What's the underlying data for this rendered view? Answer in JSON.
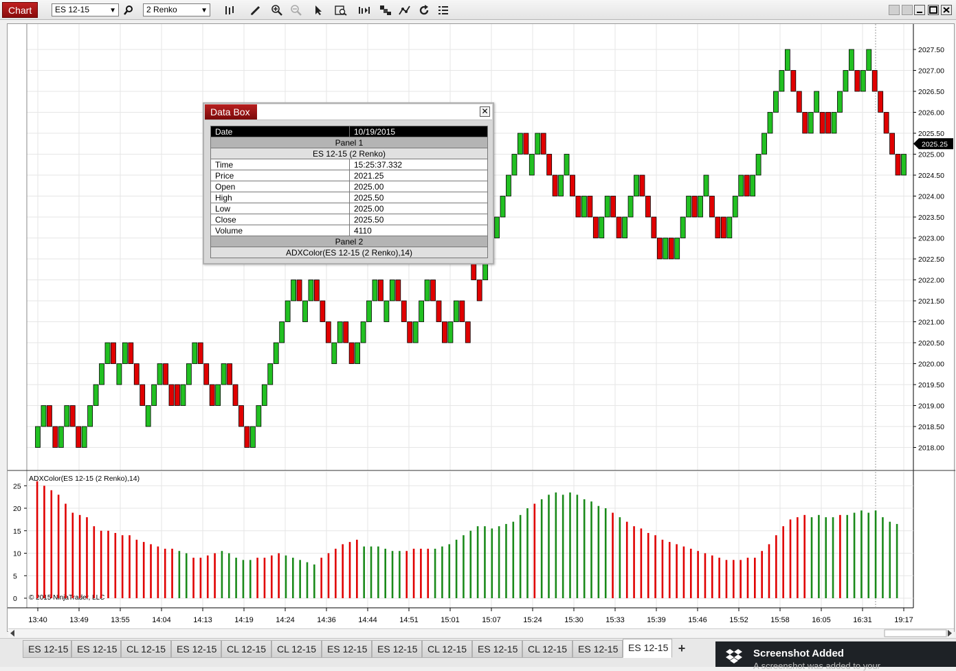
{
  "toolbar": {
    "chart_label": "Chart",
    "instrument": "ES 12-15",
    "bar_type": "2 Renko",
    "icons": [
      "search-icon",
      "bars-type-icon",
      "pencil-icon",
      "zoom-in-icon",
      "zoom-out-icon",
      "pointer-icon",
      "data-box-icon",
      "bar-spacing-icon",
      "properties-icon",
      "indicators-icon",
      "reload-icon",
      "list-icon"
    ]
  },
  "databox": {
    "title": "Data Box",
    "date_label": "Date",
    "date_value": "10/19/2015",
    "panel1": "Panel 1",
    "series1": "ES 12-15 (2 Renko)",
    "rows": [
      {
        "label": "Time",
        "value": "15:25:37.332"
      },
      {
        "label": "Price",
        "value": "2021.25"
      },
      {
        "label": "Open",
        "value": "2025.00"
      },
      {
        "label": "High",
        "value": "2025.50"
      },
      {
        "label": "Low",
        "value": "2025.00"
      },
      {
        "label": "Close",
        "value": "2025.50"
      },
      {
        "label": "Volume",
        "value": "4110"
      }
    ],
    "panel2": "Panel 2",
    "series2": "ADXColor(ES 12-15 (2 Renko),14)"
  },
  "chart_data": {
    "type": "candlestick",
    "y_ticks": [
      "2027.50",
      "2027.00",
      "2026.50",
      "2026.00",
      "2025.50",
      "2025.00",
      "2024.50",
      "2024.00",
      "2023.50",
      "2023.00",
      "2022.50",
      "2022.00",
      "2021.50",
      "2021.00",
      "2020.50",
      "2020.00",
      "2019.50",
      "2019.00",
      "2018.50",
      "2018.00"
    ],
    "ylim": [
      2017.8,
      2028.0
    ],
    "last_price": "2025.25",
    "brick_size": 0.5,
    "x_ticks": [
      "13:40",
      "13:49",
      "13:55",
      "14:04",
      "14:13",
      "14:19",
      "14:24",
      "14:36",
      "14:44",
      "14:51",
      "15:01",
      "15:07",
      "15:24",
      "15:30",
      "15:33",
      "15:39",
      "15:46",
      "15:52",
      "15:58",
      "16:05",
      "16:31",
      "19:17"
    ],
    "up_color": "#22c022",
    "down_color": "#e00000",
    "bricks": [
      [
        "u",
        2018.5
      ],
      [
        "u",
        2019.0
      ],
      [
        "d",
        2019.0
      ],
      [
        "d",
        2018.5
      ],
      [
        "u",
        2018.5
      ],
      [
        "u",
        2019.0
      ],
      [
        "d",
        2019.0
      ],
      [
        "d",
        2018.5
      ],
      [
        "u",
        2018.5
      ],
      [
        "u",
        2019.0
      ],
      [
        "u",
        2019.5
      ],
      [
        "u",
        2020.0
      ],
      [
        "u",
        2020.5
      ],
      [
        "d",
        2020.5
      ],
      [
        "u",
        2020.0
      ],
      [
        "u",
        2020.5
      ],
      [
        "d",
        2020.5
      ],
      [
        "d",
        2020.0
      ],
      [
        "d",
        2019.5
      ],
      [
        "u",
        2019.0
      ],
      [
        "u",
        2019.5
      ],
      [
        "u",
        2020.0
      ],
      [
        "d",
        2020.0
      ],
      [
        "d",
        2019.5
      ],
      [
        "d",
        2019.5
      ],
      [
        "u",
        2019.5
      ],
      [
        "u",
        2020.0
      ],
      [
        "u",
        2020.5
      ],
      [
        "d",
        2020.5
      ],
      [
        "d",
        2020.0
      ],
      [
        "d",
        2019.5
      ],
      [
        "u",
        2019.5
      ],
      [
        "u",
        2020.0
      ],
      [
        "d",
        2020.0
      ],
      [
        "d",
        2019.5
      ],
      [
        "d",
        2019.0
      ],
      [
        "d",
        2018.5
      ],
      [
        "u",
        2018.5
      ],
      [
        "u",
        2019.0
      ],
      [
        "u",
        2019.5
      ],
      [
        "u",
        2020.0
      ],
      [
        "u",
        2020.5
      ],
      [
        "u",
        2021.0
      ],
      [
        "u",
        2021.5
      ],
      [
        "u",
        2022.0
      ],
      [
        "d",
        2022.0
      ],
      [
        "u",
        2021.5
      ],
      [
        "u",
        2022.0
      ],
      [
        "d",
        2022.0
      ],
      [
        "d",
        2021.5
      ],
      [
        "d",
        2021.0
      ],
      [
        "u",
        2020.5
      ],
      [
        "u",
        2021.0
      ],
      [
        "d",
        2021.0
      ],
      [
        "d",
        2020.5
      ],
      [
        "u",
        2020.5
      ],
      [
        "u",
        2021.0
      ],
      [
        "u",
        2021.5
      ],
      [
        "u",
        2022.0
      ],
      [
        "d",
        2022.0
      ],
      [
        "u",
        2021.5
      ],
      [
        "u",
        2022.0
      ],
      [
        "d",
        2022.0
      ],
      [
        "d",
        2021.5
      ],
      [
        "d",
        2021.0
      ],
      [
        "u",
        2021.0
      ],
      [
        "u",
        2021.5
      ],
      [
        "u",
        2022.0
      ],
      [
        "d",
        2022.0
      ],
      [
        "d",
        2021.5
      ],
      [
        "d",
        2021.0
      ],
      [
        "u",
        2021.0
      ],
      [
        "u",
        2021.5
      ],
      [
        "d",
        2021.5
      ],
      [
        "d",
        2021.0
      ],
      [
        "d",
        2022.5
      ],
      [
        "d",
        2022.0
      ],
      [
        "u",
        2022.5
      ],
      [
        "u",
        2023.0
      ],
      [
        "u",
        2023.5
      ],
      [
        "u",
        2024.0
      ],
      [
        "u",
        2024.5
      ],
      [
        "u",
        2025.0
      ],
      [
        "u",
        2025.5
      ],
      [
        "d",
        2025.5
      ],
      [
        "u",
        2025.0
      ],
      [
        "u",
        2025.5
      ],
      [
        "d",
        2025.5
      ],
      [
        "d",
        2025.0
      ],
      [
        "d",
        2024.5
      ],
      [
        "u",
        2024.5
      ],
      [
        "u",
        2025.0
      ],
      [
        "d",
        2024.5
      ],
      [
        "d",
        2024.0
      ],
      [
        "u",
        2024.0
      ],
      [
        "d",
        2024.0
      ],
      [
        "d",
        2023.5
      ],
      [
        "u",
        2023.5
      ],
      [
        "u",
        2024.0
      ],
      [
        "d",
        2024.0
      ],
      [
        "d",
        2023.5
      ],
      [
        "u",
        2023.5
      ],
      [
        "u",
        2024.0
      ],
      [
        "u",
        2024.5
      ],
      [
        "d",
        2024.5
      ],
      [
        "d",
        2024.0
      ],
      [
        "d",
        2023.5
      ],
      [
        "d",
        2023.0
      ],
      [
        "u",
        2023.0
      ],
      [
        "d",
        2023.0
      ],
      [
        "u",
        2023.0
      ],
      [
        "u",
        2023.5
      ],
      [
        "u",
        2024.0
      ],
      [
        "d",
        2024.0
      ],
      [
        "u",
        2024.0
      ],
      [
        "u",
        2024.5
      ],
      [
        "d",
        2024.0
      ],
      [
        "d",
        2023.5
      ],
      [
        "d",
        2023.5
      ],
      [
        "u",
        2023.5
      ],
      [
        "u",
        2024.0
      ],
      [
        "u",
        2024.5
      ],
      [
        "d",
        2024.5
      ],
      [
        "u",
        2024.5
      ],
      [
        "u",
        2025.0
      ],
      [
        "u",
        2025.5
      ],
      [
        "u",
        2026.0
      ],
      [
        "u",
        2026.5
      ],
      [
        "u",
        2027.0
      ],
      [
        "u",
        2027.5
      ],
      [
        "d",
        2027.0
      ],
      [
        "d",
        2026.5
      ],
      [
        "d",
        2026.0
      ],
      [
        "u",
        2026.0
      ],
      [
        "u",
        2026.5
      ],
      [
        "d",
        2026.0
      ],
      [
        "d",
        2026.0
      ],
      [
        "u",
        2026.0
      ],
      [
        "u",
        2026.5
      ],
      [
        "u",
        2027.0
      ],
      [
        "u",
        2027.5
      ],
      [
        "d",
        2027.0
      ],
      [
        "u",
        2027.0
      ],
      [
        "u",
        2027.5
      ],
      [
        "d",
        2027.0
      ],
      [
        "d",
        2026.5
      ],
      [
        "d",
        2026.0
      ],
      [
        "d",
        2025.5
      ],
      [
        "d",
        2025.0
      ],
      [
        "u",
        2025.0
      ]
    ],
    "indicator": {
      "name": "ADXColor(ES 12-15 (2 Renko),14)",
      "y_ticks": [
        "25",
        "20",
        "15",
        "10",
        "5",
        "0"
      ],
      "ylim": [
        0,
        27
      ],
      "copyright": "© 2015 NinjaTrader, LLC",
      "values": [
        26,
        25,
        24,
        23,
        21,
        19,
        18.5,
        18,
        16,
        15,
        15,
        14.5,
        14,
        14,
        13,
        12.5,
        12,
        11.5,
        11,
        11,
        10.5,
        10,
        9,
        9,
        9.5,
        10,
        10.5,
        10,
        9,
        8.5,
        8.5,
        9,
        9,
        9.5,
        10,
        9.5,
        9,
        8.5,
        8,
        7.5,
        9,
        10,
        11,
        12,
        12.5,
        13,
        11.5,
        11.5,
        11.5,
        11,
        10.5,
        10.5,
        10.5,
        11,
        11,
        11,
        11,
        11.5,
        12,
        13,
        14,
        15,
        16,
        16,
        15.5,
        16,
        16.5,
        17,
        18.5,
        20,
        21,
        22,
        23,
        23.5,
        23,
        23.5,
        23,
        22,
        21.5,
        20.5,
        20,
        19,
        18,
        17,
        16,
        15.5,
        14.5,
        14,
        13,
        12.5,
        12,
        11.5,
        11,
        10.5,
        10,
        9.5,
        9,
        8.5,
        8.5,
        8.5,
        9,
        9,
        10.5,
        12,
        14,
        16,
        17.5,
        18,
        18.5,
        18,
        18.5,
        18,
        18,
        18.5,
        18.5,
        19,
        19.5,
        19,
        19.5,
        18,
        17,
        16.5
      ],
      "colors": "RRRRRRRRRRRRRRRRRRRRGGRRRRGGGGGRRRRGGGGGRRRRRRGGGGGGRRRRGGGGGGGGGGGGGGRGGGGGGGGGGRGRRRRRRRRRRRRRRRRRRRRRRRRRRGGGGRGGGGGGGGGGRGRRRRR"
    }
  },
  "tabs": [
    "ES 12-15",
    "ES 12-15",
    "CL 12-15",
    "ES 12-15",
    "CL 12-15",
    "CL 12-15",
    "ES 12-15",
    "ES 12-15",
    "CL 12-15",
    "ES 12-15",
    "CL 12-15",
    "ES 12-15",
    "ES 12-15"
  ],
  "active_tab": 12,
  "add_tab": "+",
  "toast": {
    "title": "Screenshot Added",
    "body": "A screenshot was added to your"
  }
}
